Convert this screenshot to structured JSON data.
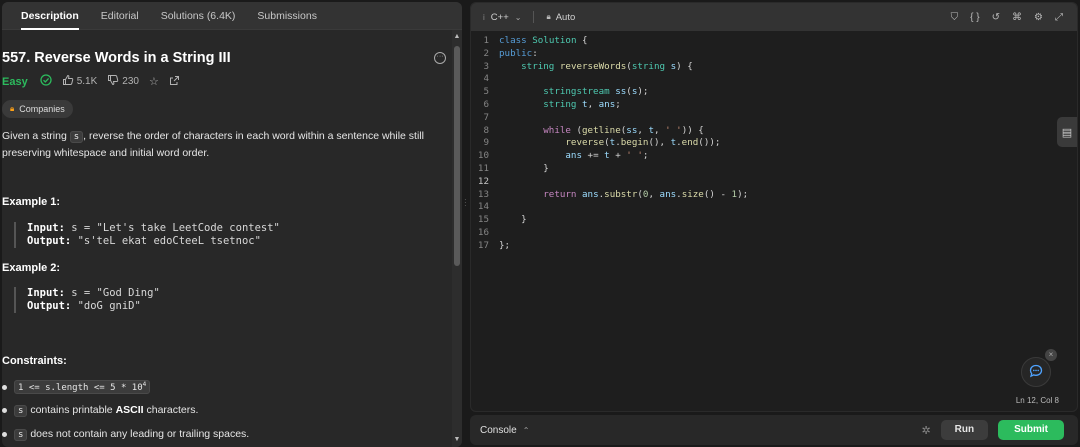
{
  "tabs": [
    {
      "label": "Description"
    },
    {
      "label": "Editorial"
    },
    {
      "label": "Solutions (6.4K)"
    },
    {
      "label": "Submissions"
    }
  ],
  "problem": {
    "title": "557. Reverse Words in a String III",
    "difficulty": "Easy",
    "likes": "5.1K",
    "dislikes": "230",
    "companies_label": "Companies",
    "desc_part1": "Given a string ",
    "desc_code": "s",
    "desc_part2": ", reverse the order of characters in each word within a sentence while still preserving whitespace and initial word order."
  },
  "examples": [
    {
      "title": "Example 1:",
      "input_label": "Input:",
      "input": "s = \"Let's take LeetCode contest\"",
      "output_label": "Output:",
      "output": "\"s'teL ekat edoCteeL tsetnoc\""
    },
    {
      "title": "Example 2:",
      "input_label": "Input:",
      "input": "s = \"God Ding\"",
      "output_label": "Output:",
      "output": "\"doG gniD\""
    }
  ],
  "constraints": {
    "title": "Constraints:",
    "c1_code": "1 <= s.length <= 5 * 10",
    "c1_sup": "4",
    "c2_code": "s",
    "c2_text_a": " contains printable ",
    "c2_bold": "ASCII",
    "c2_text_b": " characters.",
    "c3_code": "s",
    "c3_text": " does not contain any leading or trailing spaces."
  },
  "editor": {
    "language": "C++",
    "auto_label": "Auto",
    "cursor": "Ln 12, Col 8",
    "current_line": 12
  },
  "code_lines": [
    "class Solution {",
    "public:",
    "    string reverseWords(string s) {",
    "",
    "        stringstream ss(s);",
    "        string t, ans;",
    "",
    "        while (getline(ss, t, ' ')) {",
    "            reverse(t.begin(), t.end());",
    "            ans += t + ' ';",
    "        }",
    "",
    "        return ans.substr(0, ans.size() - 1);",
    "",
    "    }",
    "",
    "};"
  ],
  "console": {
    "label": "Console",
    "run_label": "Run",
    "submit_label": "Submit"
  },
  "colors": {
    "accent_green": "#2cbb5d",
    "easy": "#2cbb5d",
    "brand_orange": "#ffa116"
  }
}
